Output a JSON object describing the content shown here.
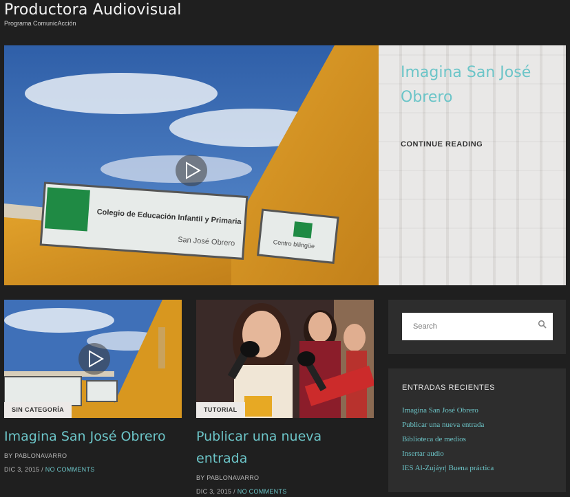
{
  "site": {
    "title": "Productora Audiovisual",
    "description": "Programa ComunicAcción"
  },
  "hero": {
    "title": "Imagina San José Obrero",
    "continue_label": "CONTINUE READING",
    "image_sign_main": "Colegio de Educación Infantil y Primaria",
    "image_sign_sub": "San José Obrero",
    "image_sign_side": "Centro bilingüe"
  },
  "posts": [
    {
      "category": "SIN CATEGORÍA",
      "title": "Imagina San José Obrero",
      "author_line": "BY PABLONAVARRO",
      "date": "DIC 3, 2015",
      "separator": "/",
      "comments": "NO COMMENTS"
    },
    {
      "category": "TUTORIAL",
      "title": "Publicar una nueva entrada",
      "author_line": "BY PABLONAVARRO",
      "date": "DIC 3, 2015",
      "separator": "/",
      "comments": "NO COMMENTS"
    }
  ],
  "sidebar": {
    "search": {
      "placeholder": "Search"
    },
    "recent": {
      "title": "ENTRADAS RECIENTES",
      "items": [
        "Imagina San José Obrero",
        "Publicar una nueva entrada",
        "Biblioteca de medios",
        "Insertar audio",
        "IES Al-Zujáyr| Buena práctica"
      ]
    }
  },
  "colors": {
    "accent": "#6cc5c8",
    "background": "#1f1f1f",
    "widget": "#2d2d2d"
  }
}
